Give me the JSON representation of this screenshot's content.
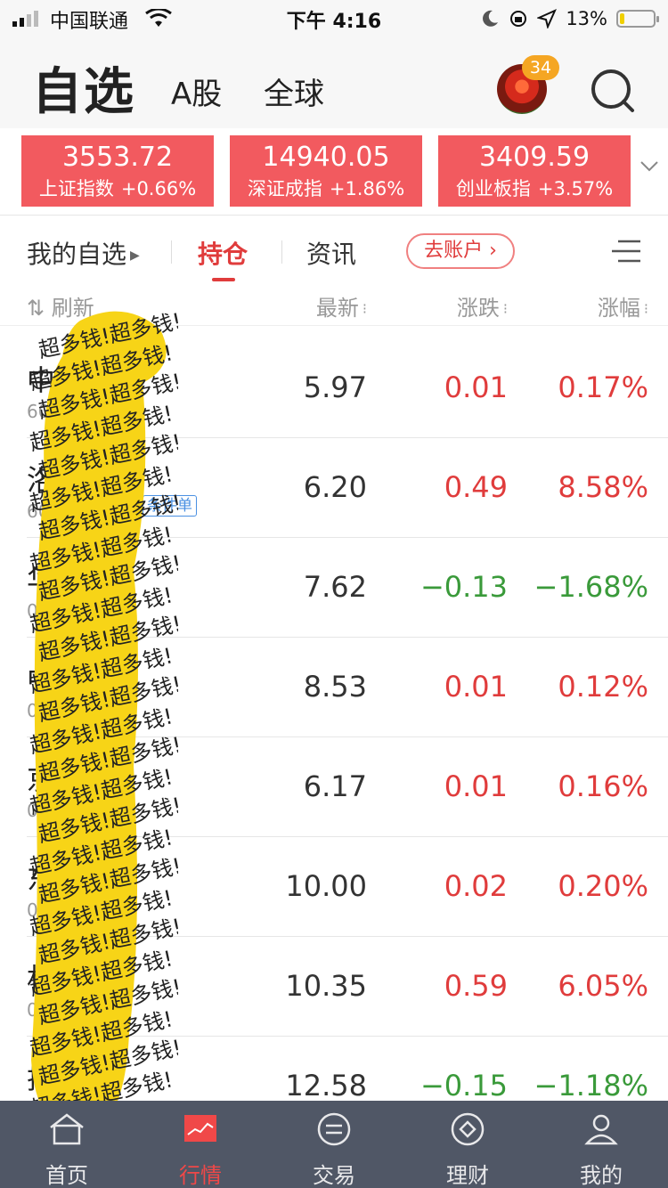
{
  "status_bar": {
    "carrier": "中国联通",
    "time": "下午 4:16",
    "battery_pct_text": "13%",
    "battery_level": 0.13
  },
  "header": {
    "title": "自选",
    "tabs": [
      "A股",
      "全球"
    ],
    "notification_count": "34"
  },
  "indices": [
    {
      "value": "3553.72",
      "name": "上证指数",
      "change": "+0.66%"
    },
    {
      "value": "14940.05",
      "name": "深证成指",
      "change": "+1.86%"
    },
    {
      "value": "3409.59",
      "name": "创业板指",
      "change": "+3.57%"
    }
  ],
  "subtabs": {
    "my_watchlist": "我的自选",
    "holdings": "持仓",
    "news": "资讯",
    "go_account": "去账户"
  },
  "columns": {
    "refresh": "刷新",
    "latest": "最新",
    "change": "涨跌",
    "change_pct": "涨幅"
  },
  "rows": [
    {
      "name": "中",
      "code": "6017",
      "latest": "5.97",
      "change": "0.01",
      "pct": "0.17%",
      "dir": "up"
    },
    {
      "name": "洛",
      "code": "60",
      "latest": "6.20",
      "change": "0.49",
      "pct": "8.58%",
      "dir": "up",
      "tag": "条件单"
    },
    {
      "name": "华",
      "code": "0",
      "latest": "7.62",
      "change": "−0.13",
      "pct": "−1.68%",
      "dir": "down"
    },
    {
      "name": "中科",
      "code": "0",
      "latest": "8.53",
      "change": "0.01",
      "pct": "0.12%",
      "dir": "up"
    },
    {
      "name": "京",
      "code": "0",
      "latest": "6.17",
      "change": "0.01",
      "pct": "0.16%",
      "dir": "up"
    },
    {
      "name": "东",
      "code": "0",
      "latest": "10.00",
      "change": "0.02",
      "pct": "0.20%",
      "dir": "up"
    },
    {
      "name": "杉",
      "code": "0",
      "latest": "10.35",
      "change": "0.59",
      "pct": "6.05%",
      "dir": "up"
    },
    {
      "name": "技",
      "code": "",
      "latest": "12.58",
      "change": "−0.15",
      "pct": "−1.18%",
      "dir": "down"
    }
  ],
  "scribble_text": "超多钱!",
  "tabbar": [
    {
      "label": "首页",
      "icon": "home-icon"
    },
    {
      "label": "行情",
      "icon": "market-chart-icon",
      "active": true
    },
    {
      "label": "交易",
      "icon": "exchange-icon"
    },
    {
      "label": "理财",
      "icon": "finance-diamond-icon"
    },
    {
      "label": "我的",
      "icon": "profile-icon"
    }
  ],
  "colors": {
    "index_card": "#f25a5f",
    "up": "#e03c3c",
    "down": "#3a9a3a",
    "tabbar_bg": "#505766",
    "scribble": "#f7d417"
  }
}
